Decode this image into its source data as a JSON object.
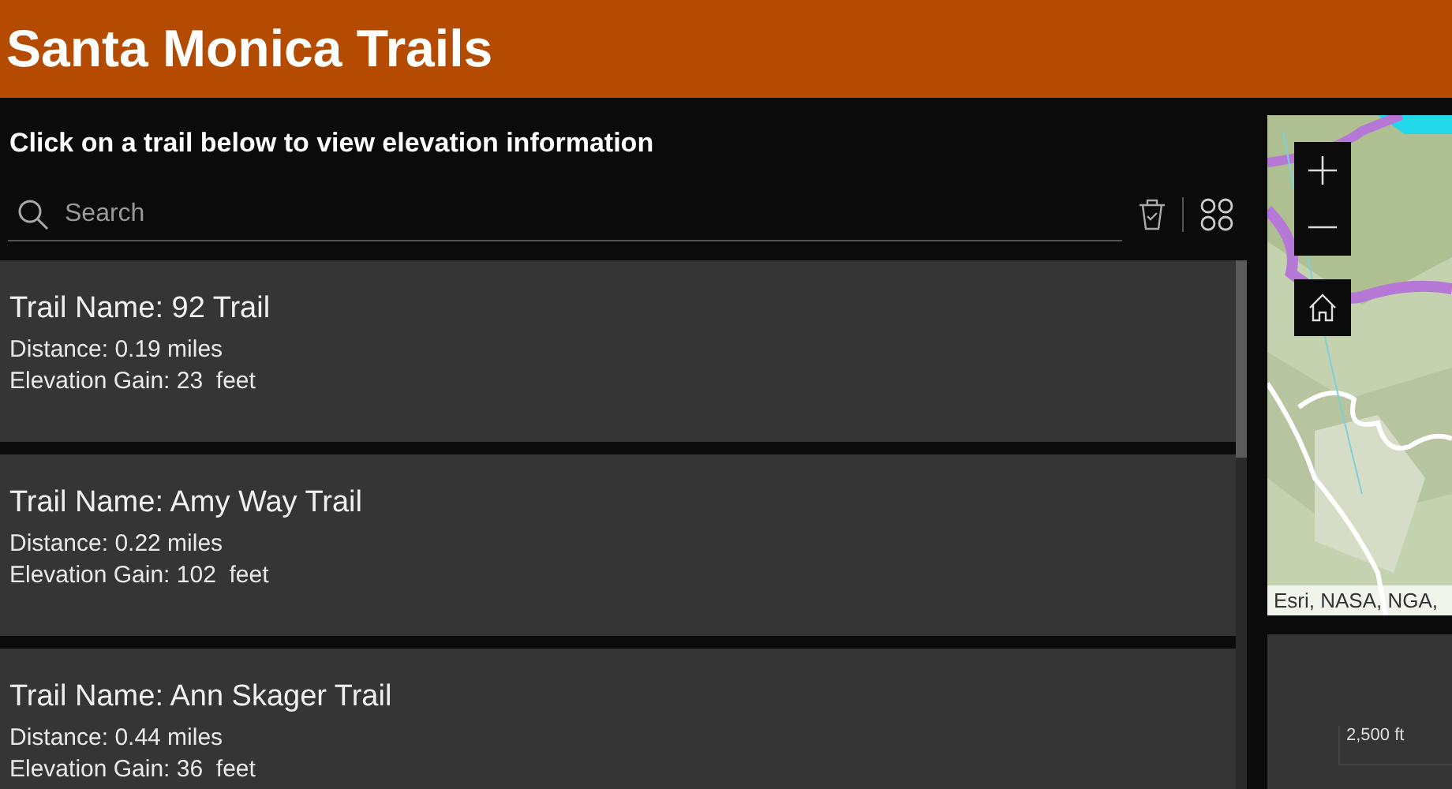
{
  "header": {
    "title": "Santa Monica Trails"
  },
  "prompt": "Click on a trail below to view elevation information",
  "search": {
    "placeholder": "Search"
  },
  "trails": [
    {
      "name_label": "Trail Name: 92 Trail",
      "distance": "Distance: 0.19 miles",
      "gain": "Elevation Gain: 23  feet"
    },
    {
      "name_label": "Trail Name: Amy Way Trail",
      "distance": "Distance: 0.22 miles",
      "gain": "Elevation Gain: 102  feet"
    },
    {
      "name_label": "Trail Name: Ann Skager Trail",
      "distance": "Distance: 0.44 miles",
      "gain": "Elevation Gain: 36  feet"
    }
  ],
  "map": {
    "kind": "picture",
    "attribution": "Esri, NASA, NGA,"
  },
  "elevation_panel": {
    "axis_label": "2,500 ft"
  }
}
